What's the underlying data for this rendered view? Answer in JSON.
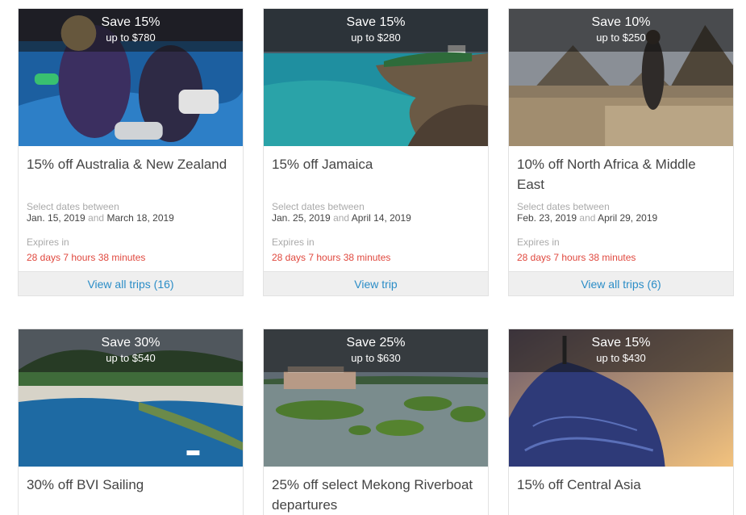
{
  "cards": [
    {
      "badge_save": "Save 15%",
      "badge_upto": "up to $780",
      "title": "15% off Australia & New Zealand",
      "dates_label": "Select dates between",
      "date_start": "Jan. 15, 2019",
      "date_and": "and",
      "date_end": "March 18, 2019",
      "expires_label": "Expires in",
      "expires_value": "28 days 7 hours 38 minutes",
      "link": "View all trips (16)"
    },
    {
      "badge_save": "Save 15%",
      "badge_upto": "up to $280",
      "title": "15% off Jamaica",
      "dates_label": "Select dates between",
      "date_start": "Jan. 25, 2019",
      "date_and": "and",
      "date_end": "April 14, 2019",
      "expires_label": "Expires in",
      "expires_value": "28 days 7 hours 38 minutes",
      "link": "View trip"
    },
    {
      "badge_save": "Save 10%",
      "badge_upto": "up to $250",
      "title": "10% off North Africa & Middle East",
      "dates_label": "Select dates between",
      "date_start": "Feb. 23, 2019",
      "date_and": "and",
      "date_end": "April 29, 2019",
      "expires_label": "Expires in",
      "expires_value": "28 days 7 hours 38 minutes",
      "link": "View all trips (6)"
    },
    {
      "badge_save": "Save 30%",
      "badge_upto": "up to $540",
      "title": "30% off BVI Sailing"
    },
    {
      "badge_save": "Save 25%",
      "badge_upto": "up to $630",
      "title": "25% off select Mekong Riverboat departures"
    },
    {
      "badge_save": "Save 15%",
      "badge_upto": "up to $430",
      "title": "15% off Central Asia"
    }
  ],
  "colors": {
    "link": "#2b8dc7",
    "countdown": "#e0483e",
    "muted": "#aaaaaa",
    "footer_bg": "#efefef"
  }
}
